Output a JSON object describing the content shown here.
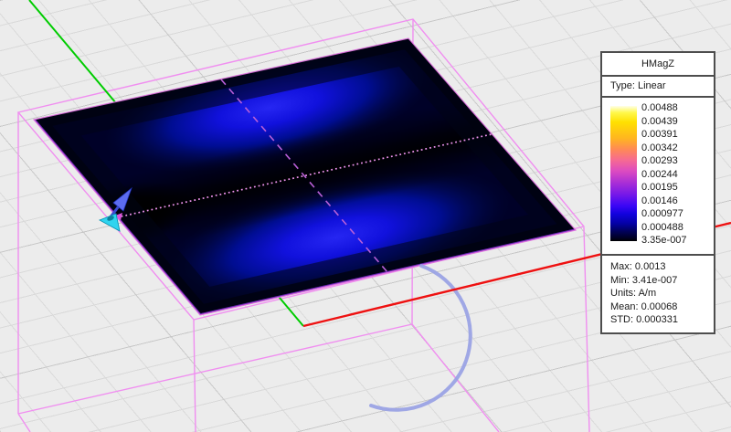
{
  "legend": {
    "title": "HMagZ",
    "type_label": "Type: Linear",
    "scale_values": [
      "0.00488",
      "0.00439",
      "0.00391",
      "0.00342",
      "0.00293",
      "0.00244",
      "0.00195",
      "0.00146",
      "0.000977",
      "0.000488",
      "3.35e-007"
    ],
    "stats": [
      "Max: 0.0013",
      "Min: 3.41e-007",
      "Units: A/m",
      "Mean: 0.00068",
      "STD: 0.000331"
    ]
  },
  "field_plot": {
    "quantity": "HMagZ",
    "scale_type": "Linear",
    "units": "A/m",
    "max": "0.0013",
    "min": "3.41e-007",
    "mean": "0.00068",
    "std": "0.000331"
  },
  "colors": {
    "background": "#ececec",
    "grid_line": "#d9d9d9",
    "wireframe_pink": "#f08ef0",
    "x_axis_red": "#ee1111",
    "y_axis_green": "#00cc00",
    "arc_lavender": "#97a0e4",
    "field_low": "#000000",
    "field_high": "#ffffe9",
    "edge_glow_violet": "#7a2ecc",
    "source_arrow_blue": "#5c6cf0",
    "source_cone_cyan": "#2fd4ef"
  }
}
